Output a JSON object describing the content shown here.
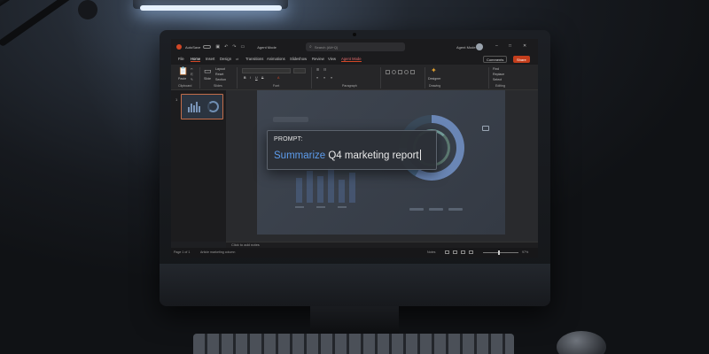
{
  "titlebar": {
    "autosave_label": "AutoSave",
    "autosave_state": "Off",
    "doc_title": "Agent Mode",
    "search_placeholder": "Search (Alt+Q)",
    "user_name": "Agent Mode",
    "controls": [
      "–",
      "□",
      "✕"
    ]
  },
  "menu": {
    "tabs": [
      "File",
      "Home",
      "Insert",
      "Design",
      "Transitions",
      "Animations",
      "Slideshow",
      "Review",
      "View",
      "Agent Mode"
    ],
    "active_tab": "Home",
    "comments_label": "Comments",
    "share_label": "Share"
  },
  "ribbon": {
    "groups": [
      "Clipboard",
      "Slides",
      "Font",
      "Paragraph",
      "Drawing",
      "Editing"
    ],
    "paste_label": "Paste",
    "new_slide_label": "Slide",
    "layout_label": "Layout",
    "reset_label": "Reset",
    "section_label": "Section",
    "designer_label": "Designer",
    "find_label": "Find",
    "replace_label": "Replace",
    "select_label": "Select"
  },
  "thumbnails": {
    "slide_number": "1"
  },
  "prompt": {
    "label": "PROMPT:",
    "keyword": "Summarize",
    "rest": " Q4 marketing report"
  },
  "notes": {
    "placeholder": "Click to add notes"
  },
  "statusbar": {
    "page": "Page 1 of 1",
    "alt_text": "Article marketing column",
    "notes_label": "Notes",
    "zoom": "97%"
  },
  "colors": {
    "accent": "#d24726",
    "prompt_keyword": "#5d9cec",
    "share_button": "#c43e1c"
  }
}
